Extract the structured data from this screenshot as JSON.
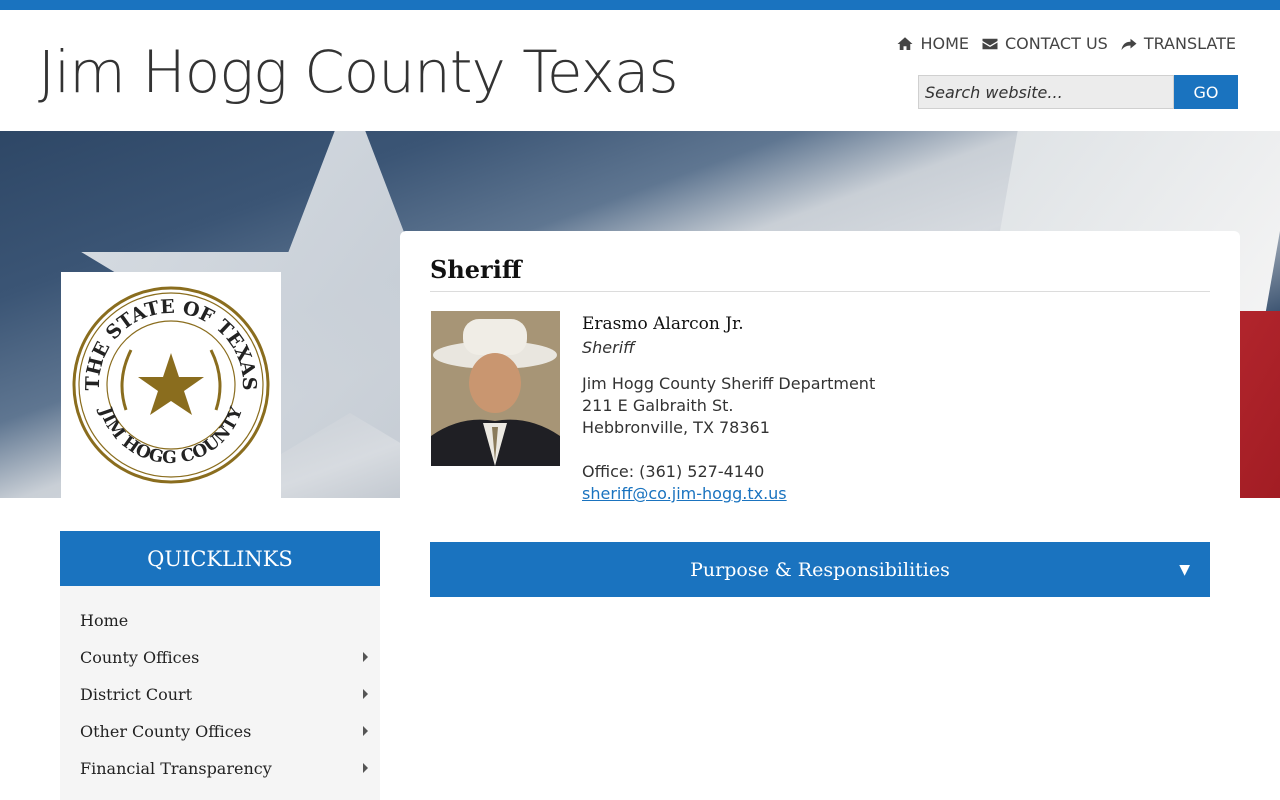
{
  "header": {
    "site_title": "Jim Hogg County Texas",
    "nav": [
      {
        "label": "HOME",
        "icon": "home-icon"
      },
      {
        "label": "CONTACT US",
        "icon": "envelope-icon"
      },
      {
        "label": "TRANSLATE",
        "icon": "share-arrow-icon"
      }
    ],
    "search": {
      "placeholder": "Search website...",
      "button_label": "GO"
    }
  },
  "seal": {
    "top_text": "THE STATE OF TEXAS",
    "bottom_text": "JIM HOGG COUNTY"
  },
  "main": {
    "page_title": "Sheriff",
    "profile": {
      "name": "Erasmo Alarcon Jr.",
      "role": "Sheriff",
      "address_lines": [
        "Jim Hogg County Sheriff Department",
        "211 E Galbraith St.",
        "Hebbronville, TX 78361"
      ],
      "phone": "Office: (361) 527-4140",
      "email": "sheriff@co.jim-hogg.tx.us"
    },
    "accordion": {
      "label": "Purpose & Responsibilities",
      "arrow": "▼"
    }
  },
  "quicklinks": {
    "title": "QUICKLINKS",
    "items": [
      {
        "label": "Home",
        "has_submenu": false
      },
      {
        "label": "County Offices",
        "has_submenu": true
      },
      {
        "label": "District Court",
        "has_submenu": true
      },
      {
        "label": "Other County Offices",
        "has_submenu": true
      },
      {
        "label": "Financial Transparency",
        "has_submenu": true
      }
    ]
  },
  "colors": {
    "accent": "#1a73bf",
    "sidebar_bg": "#f5f5f5",
    "seal_gold": "#8a6d1e"
  }
}
